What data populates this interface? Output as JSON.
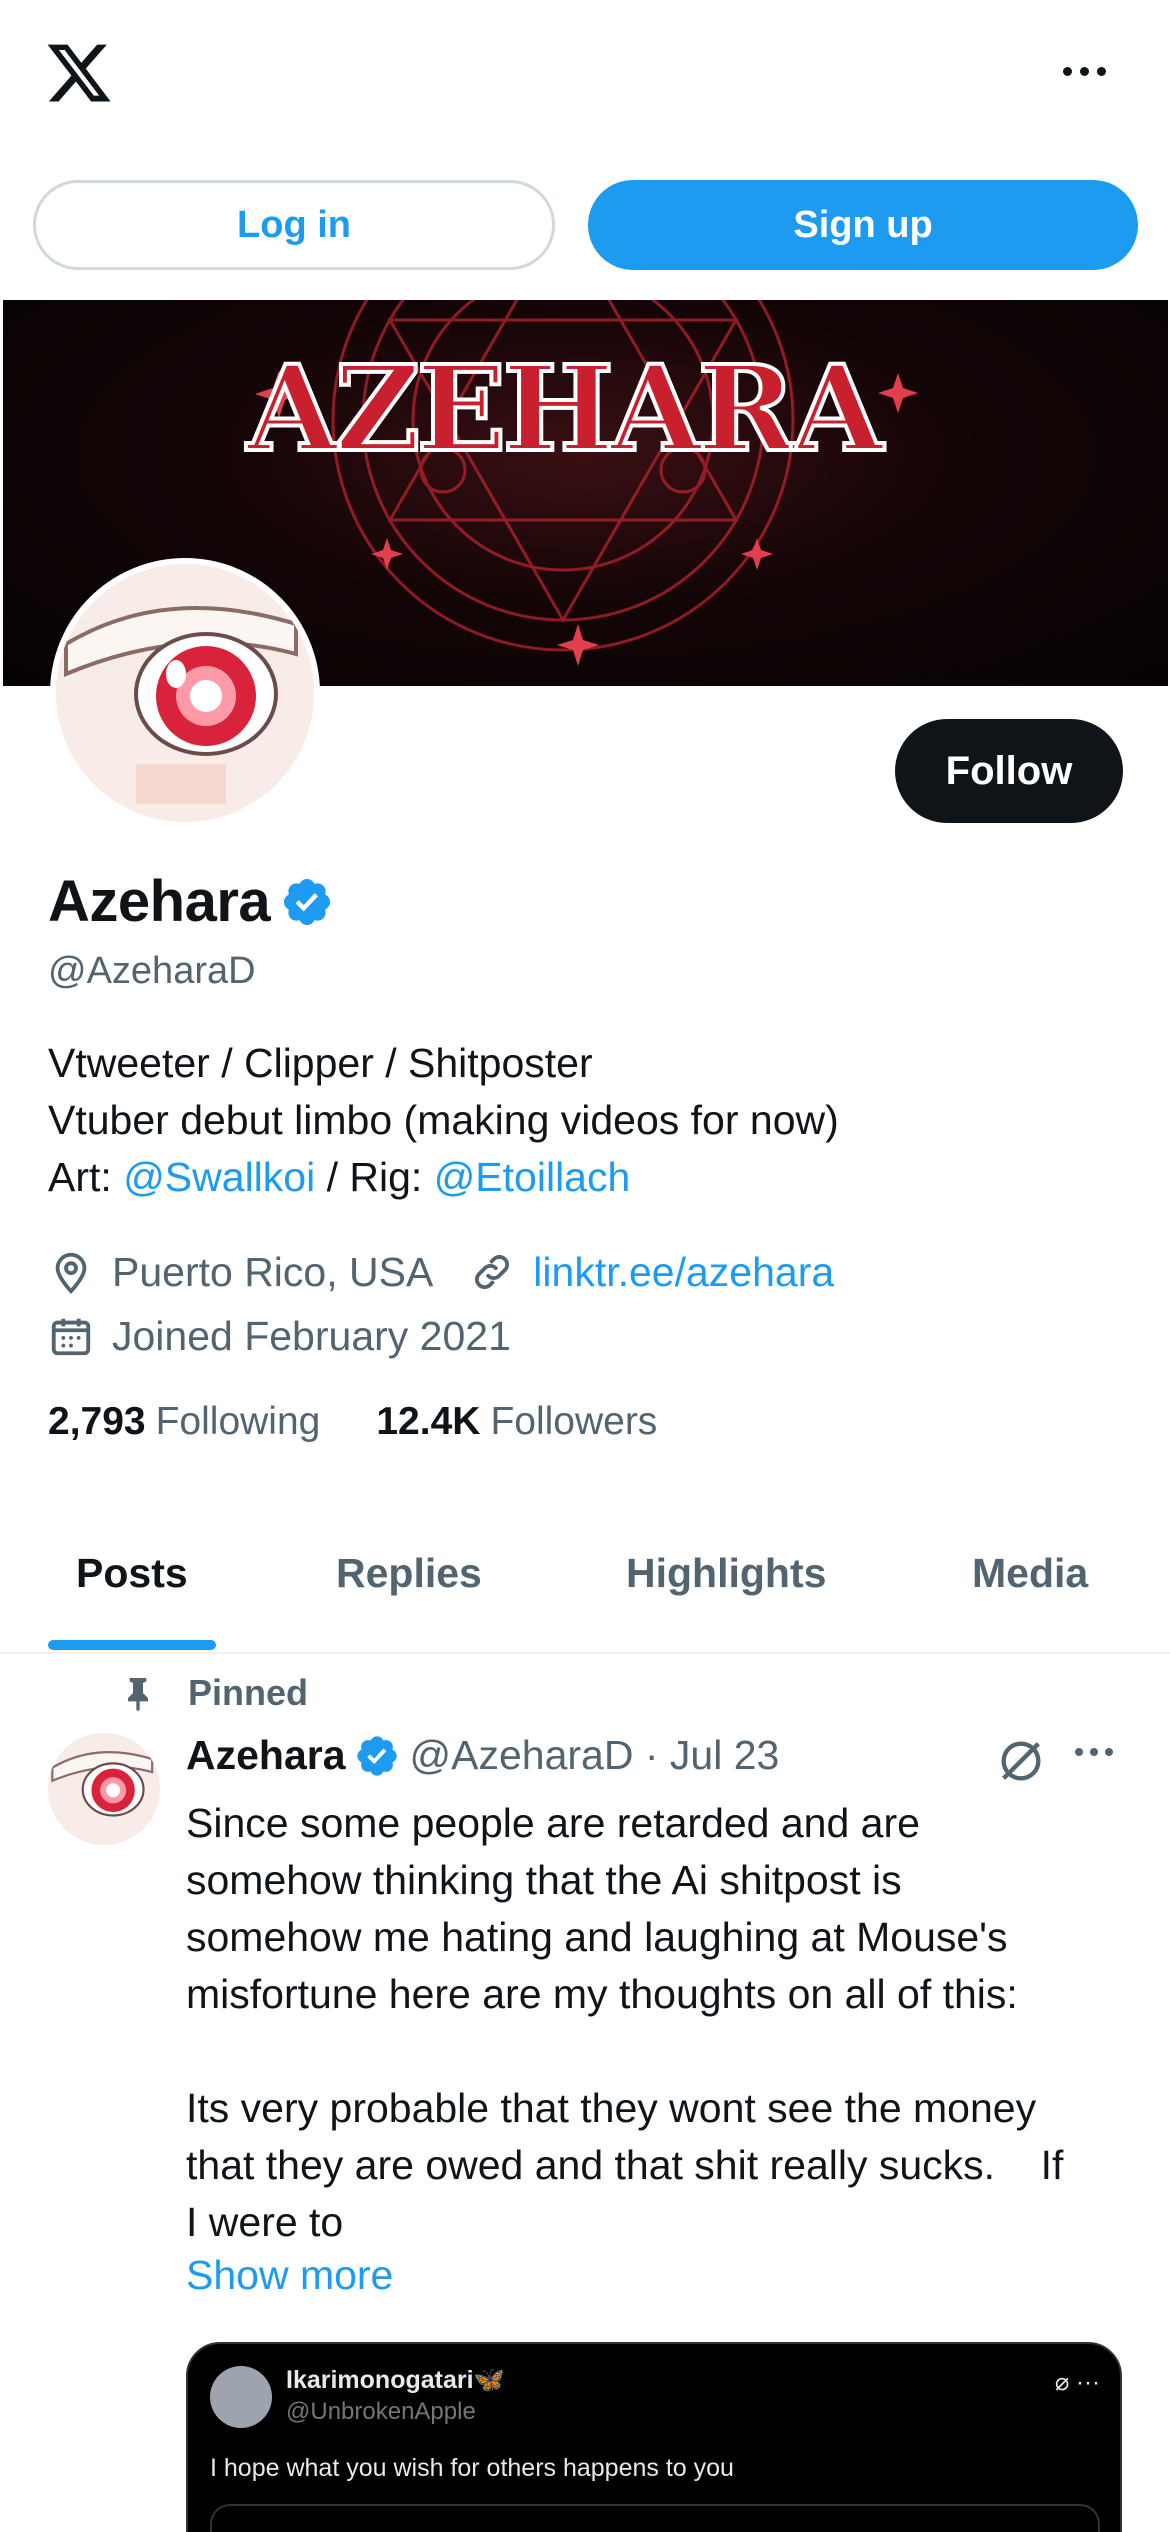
{
  "topbar": {
    "logo_icon": "x-logo-icon",
    "more_icon": "more-horizontal-icon"
  },
  "auth": {
    "login_label": "Log in",
    "signup_label": "Sign up"
  },
  "banner": {
    "title": "AZEHARA"
  },
  "profile": {
    "follow_label": "Follow",
    "display_name": "Azehara",
    "handle": "@AzeharaD",
    "bio": {
      "line1": "Vtweeter / Clipper / Shitposter",
      "line2": "Vtuber debut limbo (making videos for now)",
      "line3_prefix": "Art: ",
      "line3_art": "@Swallkoi",
      "line3_mid": " / Rig: ",
      "line3_rig": "@Etoillach"
    },
    "location": "Puerto Rico, USA",
    "website": "linktr.ee/azehara",
    "joined": "Joined February 2021",
    "following_count": "2,793",
    "following_label": "Following",
    "followers_count": "12.4K",
    "followers_label": "Followers"
  },
  "tabs": [
    "Posts",
    "Replies",
    "Highlights",
    "Media"
  ],
  "pinned_post": {
    "pinned_label": "Pinned",
    "author": "Azehara",
    "handle_date": "@AzeharaD · Jul 23",
    "text": "Since some people are retarded and are\nsomehow thinking that the Ai shitpost is\nsomehow me hating and laughing at Mouse's\nmisfortune here are my thoughts on all of this:\n\nIts very probable that they wont see the money\nthat they are owed and that shit really sucks.    If\nI were to",
    "show_more": "Show more",
    "quote": {
      "name": "Ikarimonogatari🦋",
      "handle": "@UnbrokenApple",
      "text": "I hope what you wish for others happens to you",
      "icons": "⌀ ···"
    }
  },
  "colors": {
    "accent": "#1d9bf0",
    "text": "#0f1419",
    "muted": "#536471"
  }
}
